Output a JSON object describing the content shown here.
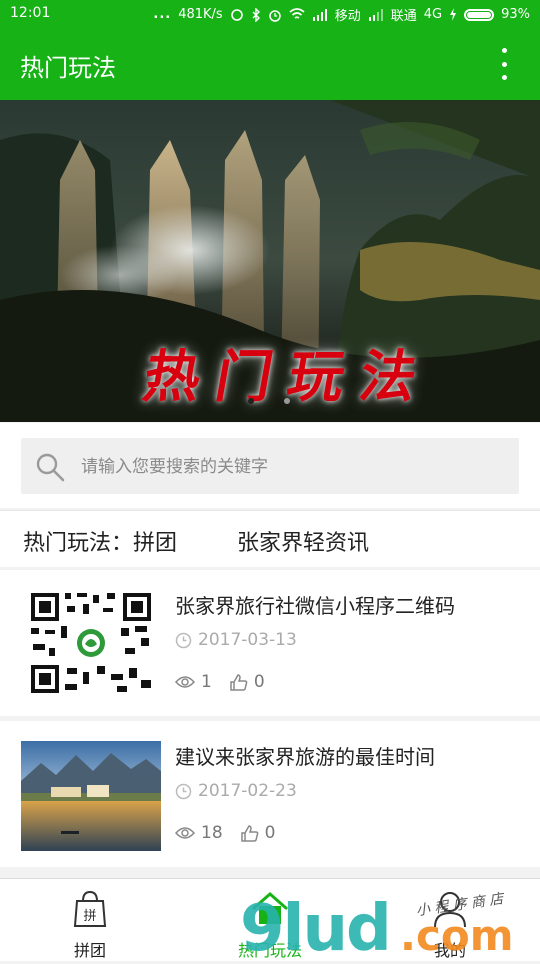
{
  "status": {
    "time": "12:01",
    "dots": "...",
    "speed": "481K/s",
    "carrier1": "移动",
    "carrier2": "联通",
    "network": "4G",
    "battery": "93%"
  },
  "appbar": {
    "title": "热门玩法",
    "menu_icon": "more-vertical-icon"
  },
  "banner": {
    "title": "热门玩法",
    "active_page": 0,
    "page_count": 2
  },
  "search": {
    "placeholder": "请输入您要搜索的关键字",
    "value": ""
  },
  "categories": {
    "label": "热门玩法：拼团",
    "other": "张家界轻资讯"
  },
  "articles": [
    {
      "title": "张家界旅行社微信小程序二维码",
      "date": "2017-03-13",
      "views": "1",
      "likes": "0",
      "thumb": "qr-code"
    },
    {
      "title": "建议来张家界旅游的最佳时间",
      "date": "2017-02-23",
      "views": "18",
      "likes": "0",
      "thumb": "lake-photo"
    }
  ],
  "tabs": [
    {
      "label": "拼团",
      "icon": "bag-icon",
      "active": false
    },
    {
      "label": "热门玩法",
      "icon": "home-icon",
      "active": true
    },
    {
      "label": "我的",
      "icon": "person-icon",
      "active": false
    }
  ],
  "watermark": {
    "brand": "9lud",
    "suffix": ".com",
    "script_text": "小程序商店"
  },
  "colors": {
    "primary": "#16b216",
    "muted": "#aaaaaa",
    "banner_title": "#d8000f"
  }
}
